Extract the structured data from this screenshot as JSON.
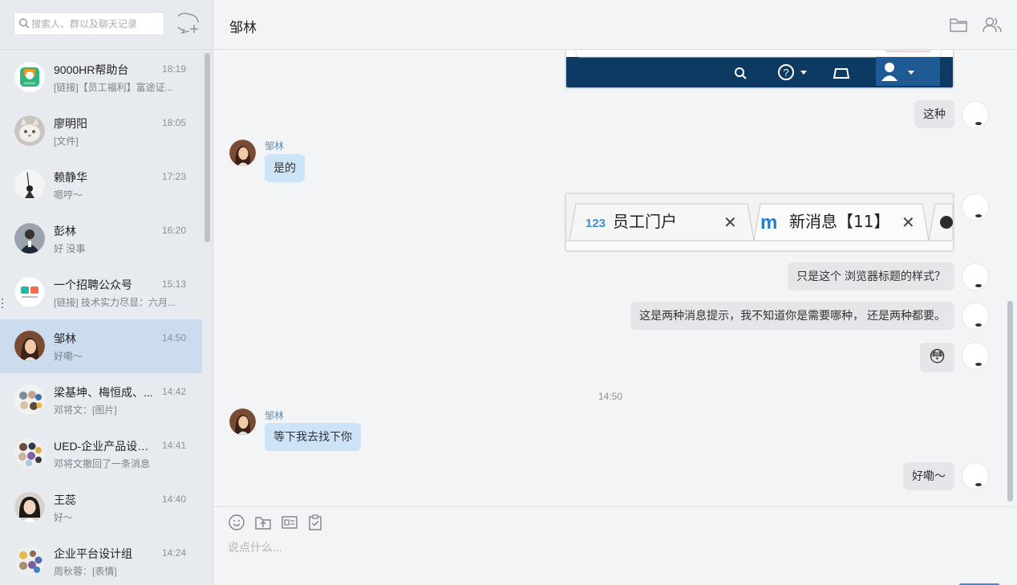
{
  "sidebar": {
    "search_placeholder": "搜索人、群以及聊天记录",
    "conversations": [
      {
        "name": "9000HR帮助台",
        "time": "18:19",
        "preview": "[链接]【员工福利】富途证...",
        "avatar": "hr-logo"
      },
      {
        "name": "廖明阳",
        "time": "18:05",
        "preview": "[文件]",
        "avatar": "cat"
      },
      {
        "name": "赖静华",
        "time": "17:23",
        "preview": "嗯哼～",
        "avatar": "figure"
      },
      {
        "name": "彭林",
        "time": "16:20",
        "preview": "好 没事",
        "avatar": "person"
      },
      {
        "name": "一个招聘公众号",
        "time": "15:13",
        "preview": "[链接] 技术实力尽显：六月...",
        "avatar": "recruit-logo"
      },
      {
        "name": "邹林",
        "time": "14:50",
        "preview": "好嘞～",
        "avatar": "girl",
        "active": true
      },
      {
        "name": "梁基坤、梅恒成、...",
        "time": "14:42",
        "preview": "邓将文：[图片]",
        "avatar": "group"
      },
      {
        "name": "UED-企业产品设计...",
        "time": "14:41",
        "preview": "邓将文撤回了一条消息",
        "avatar": "group"
      },
      {
        "name": "王蕊",
        "time": "14:40",
        "preview": "好～",
        "avatar": "woman"
      },
      {
        "name": "企业平台设计组",
        "time": "14:24",
        "preview": "周秋蓉：[表情]",
        "avatar": "group"
      }
    ]
  },
  "header": {
    "title": "邹林"
  },
  "messages": {
    "m1": {
      "text": "这种"
    },
    "m2": {
      "sender": "邹林",
      "text": "是的"
    },
    "tab_image": {
      "tab1": "员工门户",
      "tab2": "新消息【11】",
      "tab1_logo": "123",
      "tab2_logo": "m"
    },
    "m3": {
      "text": "只是这个 浏览器标题的样式？"
    },
    "m4": {
      "text": "这是两种消息提示，我不知道你是需要哪种， 还是两种都要。"
    },
    "m5": {
      "text": "😳"
    },
    "timestamp": "14:50",
    "m6": {
      "sender": "邹林",
      "text": "等下我去找下你"
    },
    "m7": {
      "text": "好嘞～"
    }
  },
  "composer": {
    "placeholder": "说点什么..."
  },
  "colors": {
    "active_row": "#cbdcee",
    "their_bubble": "#cde3f7",
    "my_bubble": "#e4e6ea",
    "sender_name": "#5f8ebb"
  }
}
